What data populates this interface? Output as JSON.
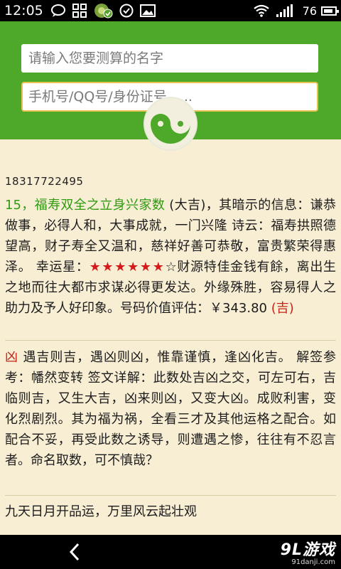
{
  "status": {
    "time": "12:05",
    "battery": "76"
  },
  "header": {
    "name_placeholder": "请输入您要测算的名字",
    "id_placeholder": "手机号/QQ号/身份证号......"
  },
  "result": {
    "phone": "18317722495",
    "para1": {
      "number": "15",
      "comma": "，",
      "title": "福寿双全之立身兴家数",
      "grade": " (大吉)",
      "text1": "，其暗示的信息：谦恭做事，必得人和，大事成就，一门兴隆 诗云：福寿拱照德望高，财子寿全又温和，慈祥好善可恭敬，富贵繁荣得惠泽。 幸运星：",
      "stars_filled": "★★★★★★",
      "stars_empty": "☆",
      "text2": "财源特佳金钱有餘，离出生之地而往大都市求谋必得更发达。外缘殊胜，容易得人之助力及予人好印象。号码价值评估：￥343.80 ",
      "valuation_tag": "(吉)"
    },
    "para2": {
      "tag": "凶",
      "text": " 遇吉则吉，遇凶则凶，惟靠谨慎，逢凶化吉。 解签参考：幡然变转 签文详解：此数处吉凶之交，可左可右，吉临则吉，又生大吉，凶来则凶，又变大凶。成败利害，变化烈剧烈。其为福为祸，全看三才及其他运格之配合。如配合不妥，再受此数之诱导，则遭遇之惨，往往有不忍言者。命名取数，可不慎哉？"
    },
    "para3": "九天日月开品运，万里风云起壮观"
  },
  "watermark": {
    "main": "9L游戏",
    "sub": "91danji.com"
  },
  "colors": {
    "header_green": "#4ea82a",
    "accent_red": "#c42418",
    "number_green": "#2f9a10",
    "content_bg": "#f7eed4"
  }
}
